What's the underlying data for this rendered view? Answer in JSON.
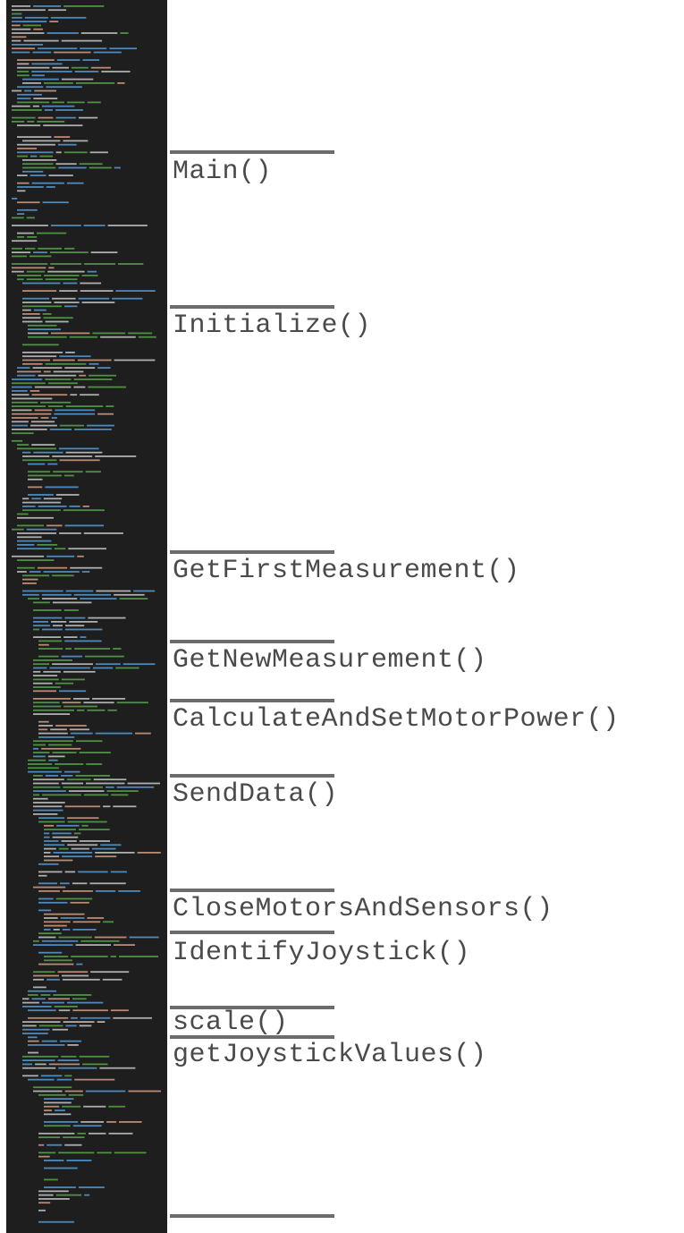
{
  "colors": {
    "code_background": "#1e1e1e",
    "divider": "#6b6b6b",
    "label_text": "#4a4a4a",
    "code_comment": "#57a64a",
    "code_keyword": "#569cd6",
    "code_text": "#c8c8c8",
    "code_string": "#d69d85"
  },
  "code_strip": {
    "name": "source-code-minimap"
  },
  "sections": [
    {
      "label": "Main()"
    },
    {
      "label": "Initialize()"
    },
    {
      "label": "GetFirstMeasurement()"
    },
    {
      "label": "GetNewMeasurement()"
    },
    {
      "label": "CalculateAndSetMotorPower()"
    },
    {
      "label": "SendData()"
    },
    {
      "label": "CloseMotorsAndSensors()"
    },
    {
      "label": "IdentifyJoystick()"
    },
    {
      "label": "scale()"
    },
    {
      "label": "getJoystickValues()"
    }
  ]
}
